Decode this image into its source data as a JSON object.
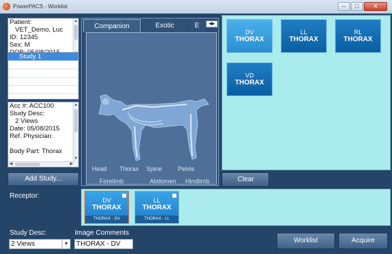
{
  "window": {
    "title": "PowerPACS - Worklist"
  },
  "patient": {
    "label": "Patient:",
    "name": "VET_Demo, Luc",
    "id": "ID: 12345",
    "sex": "Sex: M",
    "dob": "DOB: 05/08/2015"
  },
  "studies": [
    "Study 1",
    "",
    "",
    "",
    ""
  ],
  "study_info": {
    "acc": "Acc #: ACC100",
    "desc_label": "Study Desc:",
    "desc_value": "2 Views",
    "date": "Date: 05/08/2015",
    "physician": "Ref. Physician:",
    "blank": "",
    "body_part": "Body Part: Thorax"
  },
  "add_study_label": "Add Study...",
  "tabs": [
    "Companion",
    "Exotic",
    "E"
  ],
  "anatomy_labels": {
    "head": "Head",
    "thorax": "Thorax",
    "spine": "Spine",
    "pelvis": "Pelvis",
    "forelimb": "Forelimb",
    "abdomen": "Abdomen",
    "hindlimb": "Hindlimb"
  },
  "protocols": [
    {
      "top": "DV",
      "bottom": "THORAX",
      "style": "light"
    },
    {
      "top": "LL",
      "bottom": "THORAX",
      "style": "dark"
    },
    {
      "top": "RL",
      "bottom": "THORAX",
      "style": "dark"
    },
    {
      "top": "VD",
      "bottom": "THORAX",
      "style": "dark"
    }
  ],
  "clear_label": "Clear",
  "receptor_label": "Receptor:",
  "thumbnails": [
    {
      "top": "DV",
      "bottom": "THORAX",
      "caption": "THORAX - DV"
    },
    {
      "top": "LL",
      "bottom": "THORAX",
      "caption": "THORAX - LL"
    }
  ],
  "footer": {
    "study_desc_label": "Study Desc:",
    "study_desc_value": "2 Views",
    "image_comments_label": "Image Comments",
    "image_comments_value": "THORAX - DV",
    "worklist_label": "Worklist",
    "acquire_label": "Acquire"
  },
  "colors": {
    "panel": "#254568",
    "accent_cyan": "#aaebee",
    "button_blue": "#2a8fd2"
  }
}
